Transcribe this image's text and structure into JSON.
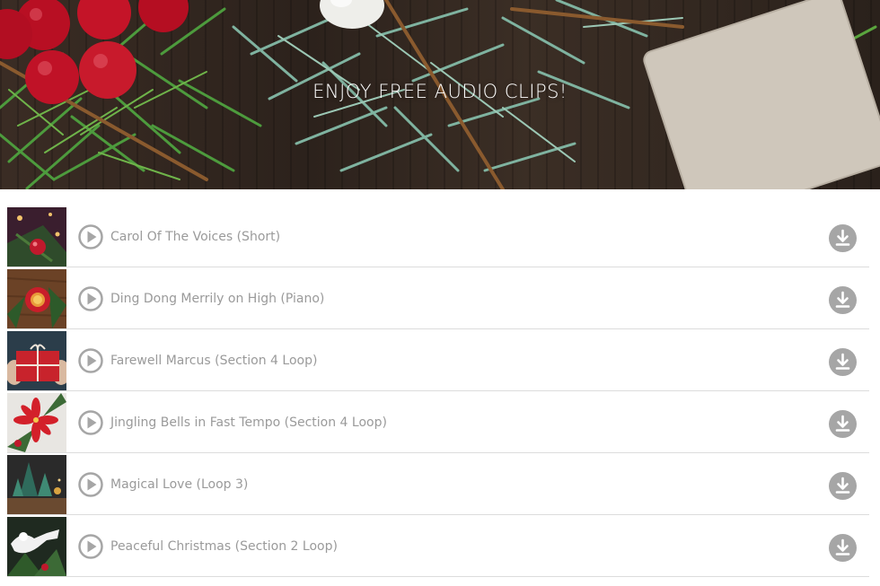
{
  "banner": {
    "title": "ENJOY FREE AUDIO CLIPS!"
  },
  "colors": {
    "title_text": "#ffffff",
    "track_text": "#9a9a9a",
    "icon_gray": "#a6a6a6",
    "divider": "#dcdcdc"
  },
  "tracks": [
    {
      "title": "Carol Of The Voices (Short)",
      "thumbnail": "christmas-tree-ornament"
    },
    {
      "title": "Ding Dong Merrily on High (Piano)",
      "thumbnail": "red-mug"
    },
    {
      "title": "Farewell Marcus (Section 4 Loop)",
      "thumbnail": "gift-box"
    },
    {
      "title": "Jingling Bells in Fast Tempo (Section 4 Loop)",
      "thumbnail": "poinsettia"
    },
    {
      "title": "Magical Love (Loop 3)",
      "thumbnail": "small-trees"
    },
    {
      "title": "Peaceful Christmas (Section 2 Loop)",
      "thumbnail": "angel-trumpet"
    }
  ]
}
